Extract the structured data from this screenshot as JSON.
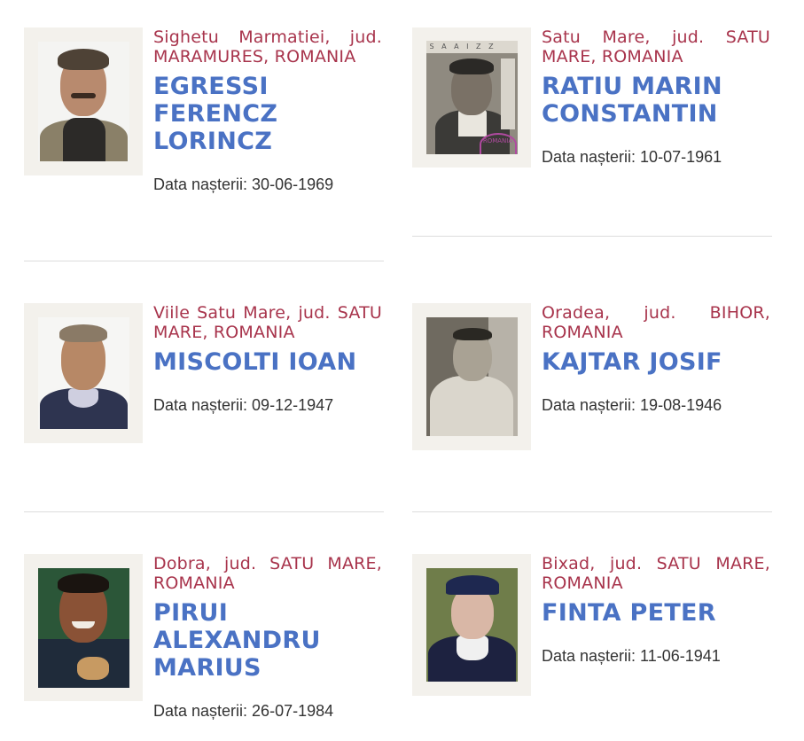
{
  "dob_label": "Data nașterii:",
  "people": [
    {
      "location": "Sighetu Marmatiei, jud. MARAMURES, ROMANIA",
      "name": "EGRESSI FERENCZ LORINCZ",
      "dob": "Data nașterii: 30-06-1969"
    },
    {
      "location": "Satu Mare, jud. SATU MARE, ROMANIA",
      "name": "RATIU MARIN CONSTANTIN",
      "dob": "Data nașterii: 10-07-1961",
      "photo_stamp": "S A A I Z Z",
      "photo_seal": "ROMANIA"
    },
    {
      "location": "Viile Satu Mare, jud. SATU MARE, ROMANIA",
      "name": "MISCOLTI IOAN",
      "dob": "Data nașterii: 09-12-1947"
    },
    {
      "location": "Oradea, jud. BIHOR, ROMANIA",
      "name": "KAJTAR JOSIF",
      "dob": "Data nașterii: 19-08-1946"
    },
    {
      "location": "Dobra, jud. SATU MARE, ROMANIA",
      "name": "PIRUI ALEXANDRU MARIUS",
      "dob": "Data nașterii: 26-07-1984"
    },
    {
      "location": "Bixad, jud. SATU MARE, ROMANIA",
      "name": "FINTA PETER",
      "dob": "Data nașterii: 11-06-1941"
    }
  ],
  "colors": {
    "location": "#a8344c",
    "name": "#4a72c4",
    "text": "#333333",
    "frame": "#f3f1ec",
    "divider": "#dddddd"
  }
}
